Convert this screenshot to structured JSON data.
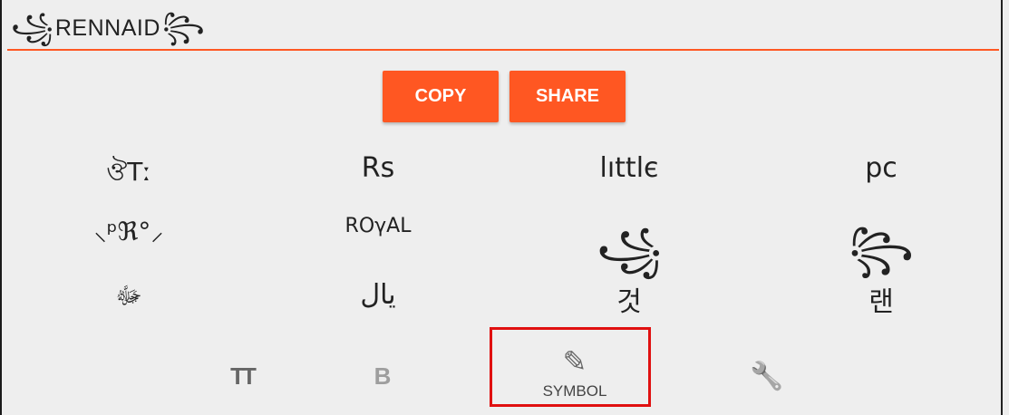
{
  "input": {
    "deco_left": "꧁",
    "text": "RENNAID",
    "deco_right": "꧂"
  },
  "buttons": {
    "copy": "COPY",
    "share": "SHARE"
  },
  "symbols": [
    {
      "label": "ঔTː"
    },
    {
      "label": "Rs"
    },
    {
      "label": "lıttlє"
    },
    {
      "label": "pc"
    },
    {
      "label": "⸜ᵖℜ°⸝"
    },
    {
      "label": "RΟγAL"
    },
    {
      "label": "꧁"
    },
    {
      "label": "꧂"
    },
    {
      "label": "ﷻ"
    },
    {
      "label": "يال"
    },
    {
      "label": "것"
    },
    {
      "label": "랜"
    }
  ],
  "nav": {
    "fonts_icon": "TT",
    "bold_icon": "B",
    "symbol_icon": "✎",
    "symbol_label": "SYMBOL",
    "tools_icon": "🔧"
  },
  "colors": {
    "accent": "#ff5722",
    "highlight": "#e01010"
  }
}
